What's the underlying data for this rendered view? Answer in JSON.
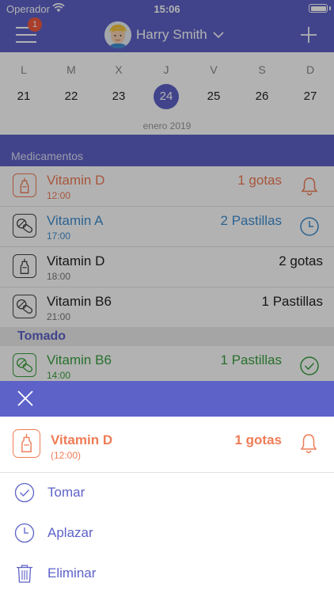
{
  "status_bar": {
    "carrier": "Operador",
    "time": "15:06"
  },
  "nav": {
    "badge_count": "1",
    "user_name": "Harry Smith"
  },
  "calendar": {
    "days": [
      {
        "letter": "L",
        "num": "21",
        "selected": false
      },
      {
        "letter": "M",
        "num": "22",
        "selected": false
      },
      {
        "letter": "X",
        "num": "23",
        "selected": false
      },
      {
        "letter": "J",
        "num": "24",
        "selected": true
      },
      {
        "letter": "V",
        "num": "25",
        "selected": false
      },
      {
        "letter": "S",
        "num": "26",
        "selected": false
      },
      {
        "letter": "D",
        "num": "27",
        "selected": false
      }
    ],
    "month_label": "enero 2019"
  },
  "medications": {
    "section_title": "Medicamentos",
    "items": [
      {
        "name": "Vitamin D",
        "time": "12:00",
        "dose": "1 gotas",
        "icon": "dropper-icon",
        "status": "bell-icon",
        "color": "#ef7c56"
      },
      {
        "name": "Vitamin A",
        "time": "17:00",
        "dose": "2 Pastillas",
        "icon": "pills-icon",
        "status": "clock-icon",
        "color": "#3f8fd0"
      },
      {
        "name": "Vitamin D",
        "time": "18:00",
        "dose": "2 gotas",
        "icon": "dropper-icon",
        "status": "",
        "color": "#222222"
      },
      {
        "name": "Vitamin B6",
        "time": "21:00",
        "dose": "1 Pastillas",
        "icon": "pills-icon",
        "status": "",
        "color": "#222222"
      }
    ]
  },
  "taken": {
    "section_title": "Tomado",
    "items": [
      {
        "name": "Vitamin B6",
        "time": "14:00",
        "dose": "1 Pastillas",
        "icon": "pills-icon",
        "status": "check-circle-icon",
        "color": "#3aa140"
      }
    ]
  },
  "sheet": {
    "med_name": "Vitamin D",
    "med_time": "(12:00)",
    "med_dose": "1 gotas",
    "accent_color": "#ef7c56",
    "actions": [
      {
        "label": "Tomar",
        "icon": "check-circle-icon"
      },
      {
        "label": "Aplazar",
        "icon": "clock-icon"
      },
      {
        "label": "Eliminar",
        "icon": "trash-icon"
      }
    ]
  },
  "colors": {
    "primary": "#5d62c8",
    "orange": "#ef7c56",
    "blue": "#3f8fd0",
    "green": "#3aa140"
  }
}
